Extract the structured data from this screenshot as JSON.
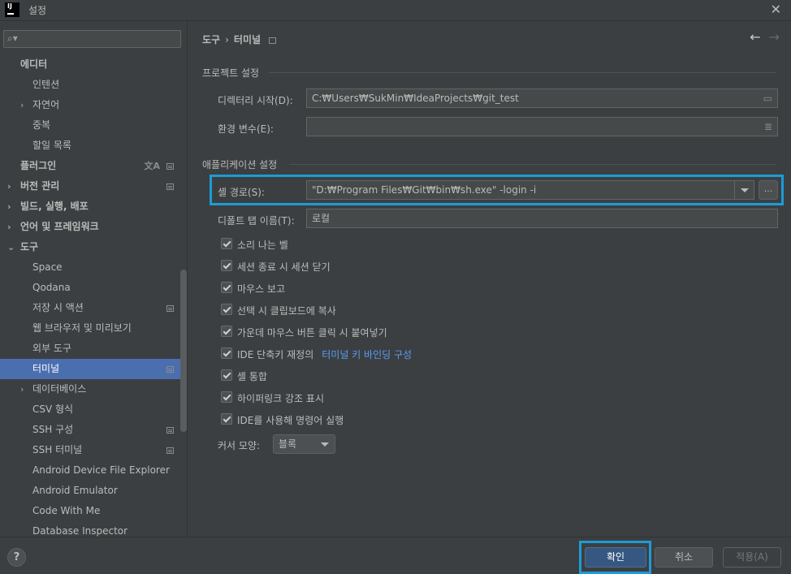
{
  "window": {
    "title": "설정",
    "logo_text": "IJ"
  },
  "sidebar": {
    "search_placeholder": "",
    "items": [
      {
        "label": "에디터",
        "level": 0,
        "bold": true,
        "expandable": false
      },
      {
        "label": "인텐션",
        "level": 1
      },
      {
        "label": "자연어",
        "level": 1,
        "expandable": true
      },
      {
        "label": "중복",
        "level": 1
      },
      {
        "label": "할일 목록",
        "level": 1
      },
      {
        "label": "플러그인",
        "level": 0,
        "bold": true,
        "badge": true,
        "translate": true
      },
      {
        "label": "버전 관리",
        "level": 0,
        "bold": true,
        "expandable": true,
        "badge": true
      },
      {
        "label": "빌드, 실행, 배포",
        "level": 0,
        "bold": true,
        "expandable": true
      },
      {
        "label": "언어 및 프레임워크",
        "level": 0,
        "bold": true,
        "expandable": true
      },
      {
        "label": "도구",
        "level": 0,
        "bold": true,
        "expanded": true
      },
      {
        "label": "Space",
        "level": 1
      },
      {
        "label": "Qodana",
        "level": 1
      },
      {
        "label": "저장 시 액션",
        "level": 1,
        "badge": true
      },
      {
        "label": "웹 브라우저 및 미리보기",
        "level": 1
      },
      {
        "label": "외부 도구",
        "level": 1
      },
      {
        "label": "터미널",
        "level": 1,
        "selected": true,
        "badge": true
      },
      {
        "label": "데이터베이스",
        "level": 1,
        "expandable": true
      },
      {
        "label": "CSV 형식",
        "level": 1
      },
      {
        "label": "SSH 구성",
        "level": 1,
        "badge": true
      },
      {
        "label": "SSH 터미널",
        "level": 1,
        "badge": true
      },
      {
        "label": "Android Device File Explorer",
        "level": 1
      },
      {
        "label": "Android Emulator",
        "level": 1
      },
      {
        "label": "Code With Me",
        "level": 1
      },
      {
        "label": "Database Inspector",
        "level": 1
      }
    ]
  },
  "breadcrumb": {
    "parent": "도구",
    "current": "터미널"
  },
  "project_section": {
    "title": "프로젝트 설정",
    "start_dir_label": "디렉터리 시작(D):",
    "start_dir_value": "C:₩Users₩SukMin₩IdeaProjects₩git_test",
    "env_label": "환경 변수(E):",
    "env_value": ""
  },
  "app_section": {
    "title": "애플리케이션 설정",
    "shell_path_label": "셸 경로(S):",
    "shell_path_value": "\"D:₩Program Files₩Git₩bin₩sh.exe\" -login -i",
    "browse_label": "...",
    "default_tab_label": "디폴트 탭 이름(T):",
    "default_tab_value": "로컬",
    "checkboxes": [
      {
        "label": "소리 나는 벨",
        "checked": true
      },
      {
        "label": "세션 종료 시 세션 닫기",
        "checked": true
      },
      {
        "label": "마우스 보고",
        "checked": true
      },
      {
        "label": "선택 시 클립보드에 복사",
        "checked": true
      },
      {
        "label": "가운데 마우스 버튼 클릭 시 붙여넣기",
        "checked": true
      },
      {
        "label": "IDE 단축키 재정의",
        "checked": true,
        "link": "터미널 키 바인딩 구성"
      },
      {
        "label": "셸 통합",
        "checked": true
      },
      {
        "label": "하이퍼링크 강조 표시",
        "checked": true
      },
      {
        "label": "IDE를 사용해 명령어 실행",
        "checked": true
      }
    ],
    "cursor_shape_label": "커서 모양:",
    "cursor_shape_value": "블록"
  },
  "footer": {
    "help": "?",
    "ok": "확인",
    "cancel": "취소",
    "apply": "적용(A)"
  },
  "colors": {
    "background": "#3c3f41",
    "selection": "#4b6eaf",
    "highlight_box": "#1e9bd7",
    "link": "#589df6",
    "ok_button": "#365880"
  }
}
